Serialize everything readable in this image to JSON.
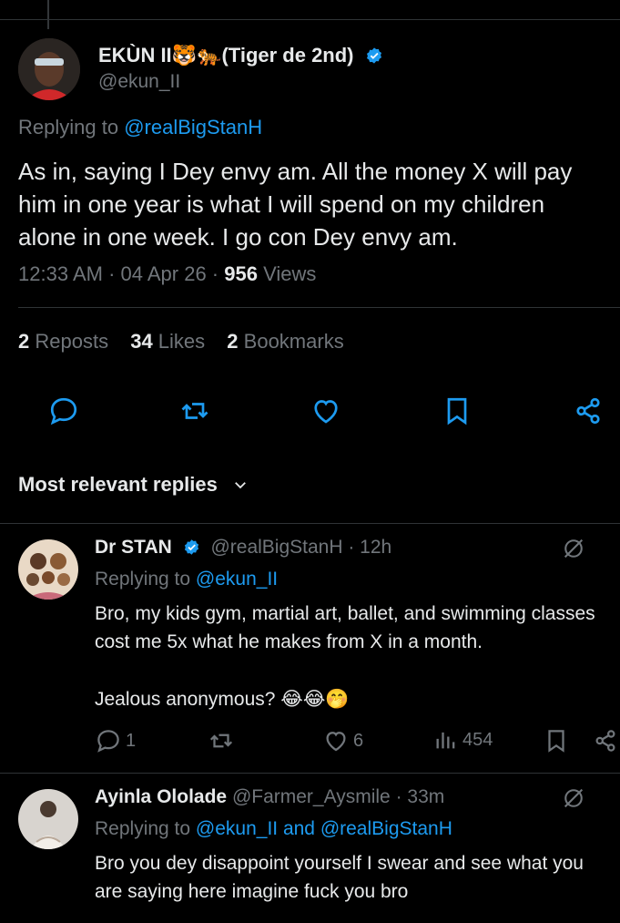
{
  "main_tweet": {
    "author_name": "EKÙN II🐯🐅(Tiger de 2nd)",
    "author_handle": "@ekun_II",
    "replying_prefix": "Replying to ",
    "replying_to": "@realBigStanH",
    "text_lines": [
      "As in, saying I Dey envy am. All the money X will pay",
      "him in one year is what I will spend on my children",
      "alone in one week. I go con Dey envy am."
    ],
    "time": "12:33 AM · 04 Apr 26 · ",
    "views_count": "956",
    "views_label": " Views",
    "reposts_count": "2",
    "reposts_label": " Reposts",
    "likes_count": "34",
    "likes_label": " Likes",
    "bookmarks_count": "2",
    "bookmarks_label": " Bookmarks",
    "actions": [
      "reply-icon",
      "repost-icon",
      "like-icon",
      "bookmark-icon",
      "share-icon"
    ]
  },
  "replies_header": {
    "label": "Most relevant replies"
  },
  "replies": [
    {
      "name": "Dr STAN",
      "handle": "@realBigStanH · 12h",
      "replying_prefix": "Replying to ",
      "replying_to": "@ekun_II",
      "text_lines": [
        "Bro, my kids gym, martial art,  ballet, and swimming classes",
        "cost me 5x what he makes from X in a month.",
        "",
        "Jealous anonymous? 😂😂🤭"
      ],
      "reply_count": "1",
      "repost_count": "",
      "like_count": "6",
      "views_count": "454"
    },
    {
      "name": "Ayinla Ololade",
      "handle": "@Farmer_Aysmile · 33m",
      "replying_prefix": "Replying to ",
      "replying_to": "@ekun_II and @realBigStanH",
      "text_lines": [
        "Bro you dey disappoint yourself I swear and see what you",
        "are saying here imagine fuck you bro"
      ]
    }
  ],
  "colors": {
    "background": "#000000",
    "text": "#e7e9ea",
    "secondary": "#71767b",
    "link": "#1d9bf0",
    "divider": "#2f3336"
  }
}
